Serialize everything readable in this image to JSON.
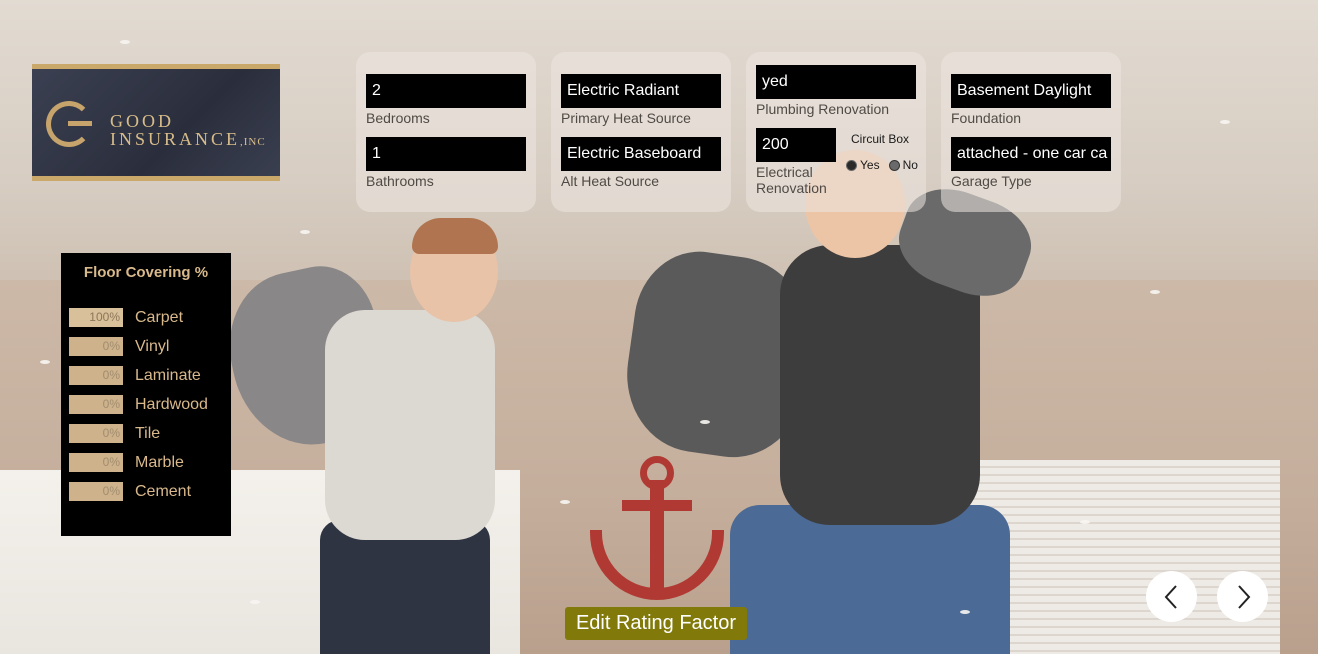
{
  "logo": {
    "line1": "GOOD",
    "line2": "INSURANCE",
    "suffix": ",INC"
  },
  "cards": {
    "bedrooms": {
      "value": "2",
      "label": "Bedrooms"
    },
    "bathrooms": {
      "value": "1",
      "label": "Bathrooms"
    },
    "primary_heat": {
      "value": "Electric Radiant",
      "label": "Primary Heat Source"
    },
    "alt_heat": {
      "value": "Electric Baseboard",
      "label": "Alt Heat Source"
    },
    "plumbing": {
      "value": "yed",
      "label": "Plumbing Renovation"
    },
    "electrical": {
      "value": "200",
      "label_line1": "Electrical",
      "label_line2": "Renovation"
    },
    "circuit_box": {
      "title": "Circuit Box",
      "yes": "Yes",
      "no": "No"
    },
    "foundation": {
      "value": "Basement Daylight",
      "label": "Foundation"
    },
    "garage": {
      "value": "attached - one car ca",
      "label": "Garage Type"
    }
  },
  "floor_covering": {
    "title": "Floor Covering %",
    "items": [
      {
        "pct": "100%",
        "name": "Carpet"
      },
      {
        "pct": "0%",
        "name": "Vinyl"
      },
      {
        "pct": "0%",
        "name": "Laminate"
      },
      {
        "pct": "0%",
        "name": "Hardwood"
      },
      {
        "pct": "0%",
        "name": "Tile"
      },
      {
        "pct": "0%",
        "name": "Marble"
      },
      {
        "pct": "0%",
        "name": "Cement"
      }
    ]
  },
  "actions": {
    "edit_label": "Edit Rating Factor"
  },
  "icons": {
    "prev": "chevron-left-icon",
    "next": "chevron-right-icon"
  },
  "colors": {
    "accent_gold": "#d9b98c",
    "edit_button": "#817a0b",
    "field_bg": "#000000"
  }
}
